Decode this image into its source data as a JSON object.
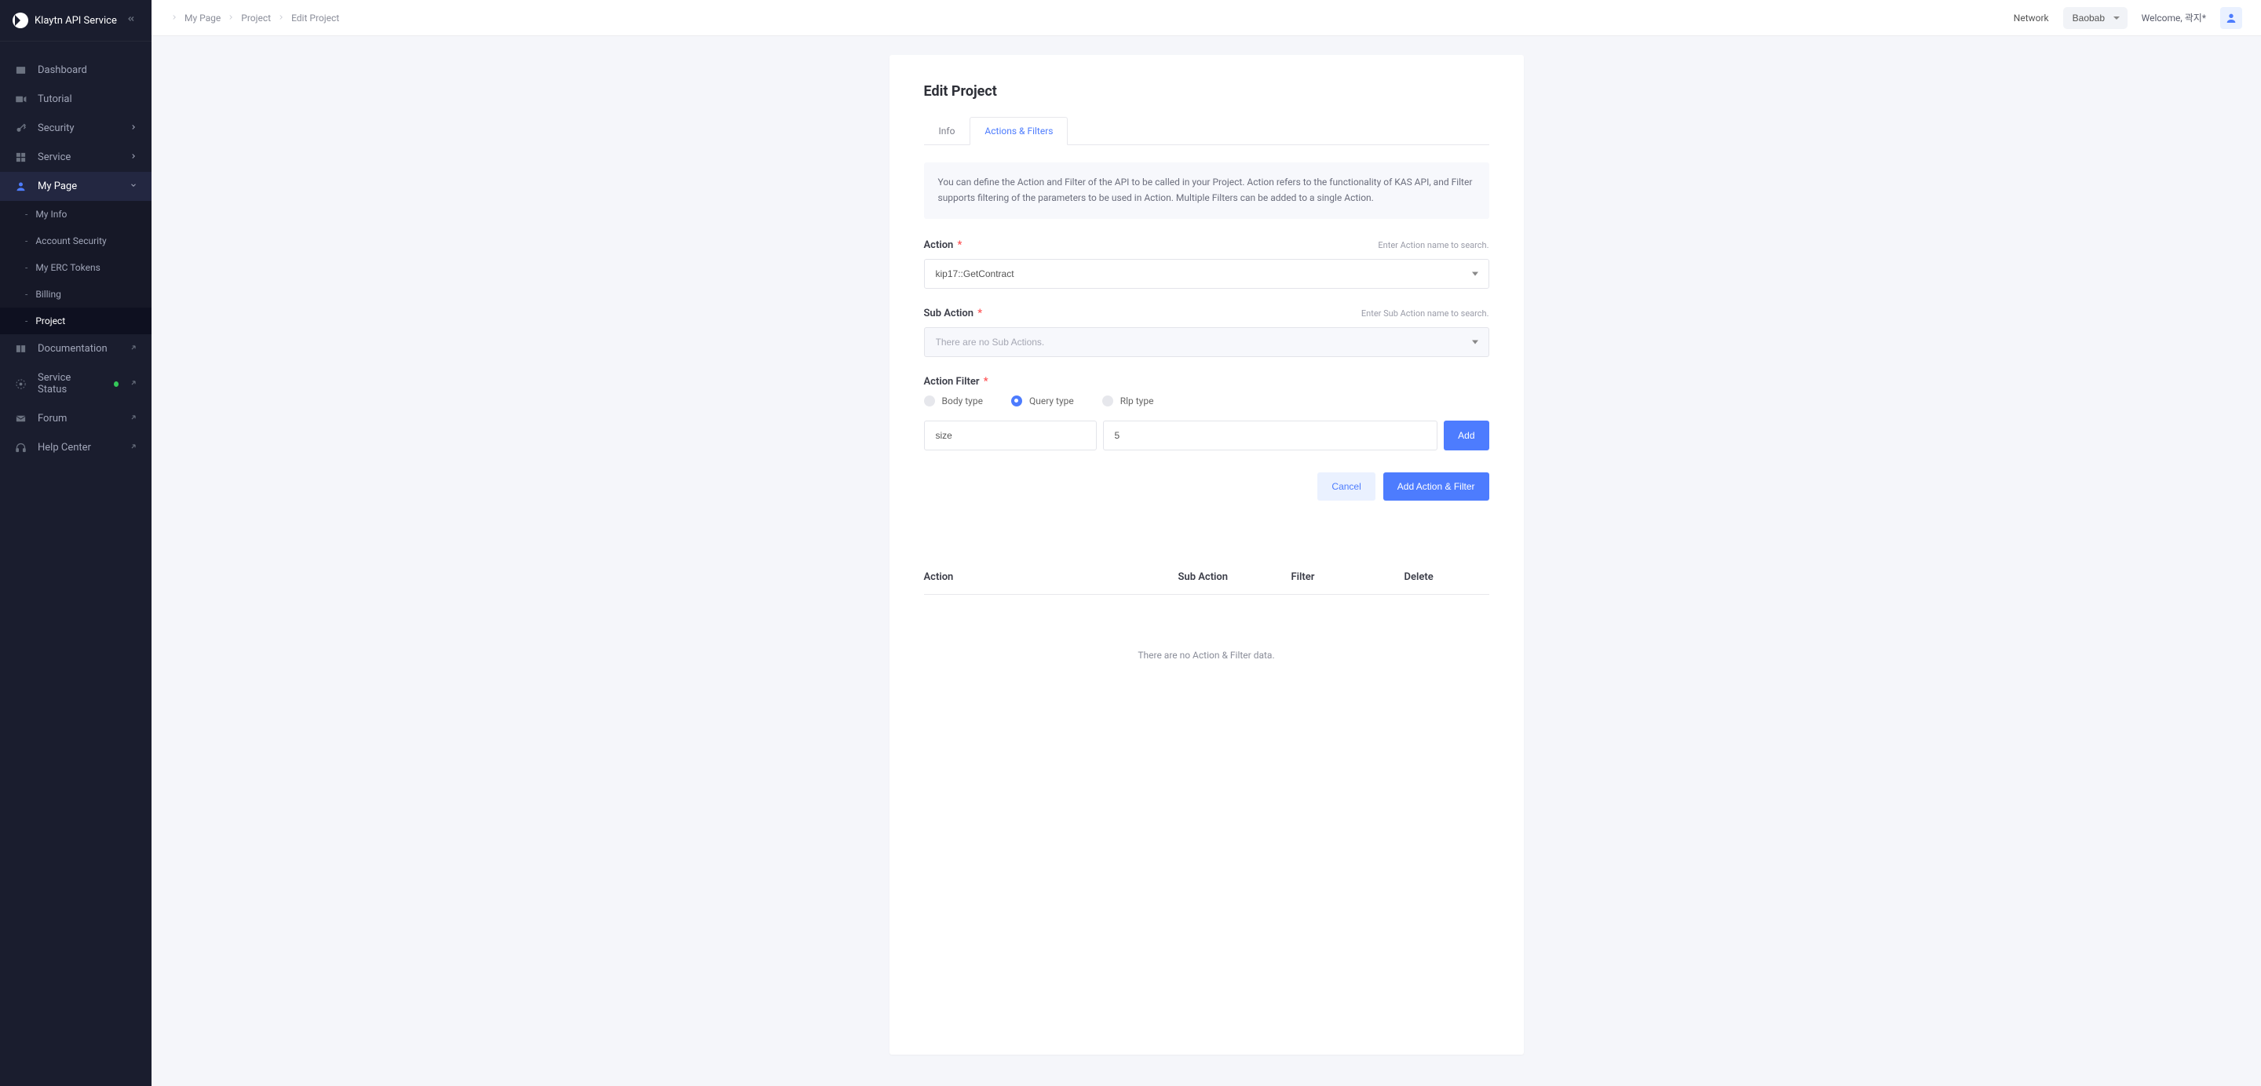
{
  "brand": "Klaytn API Service",
  "sidebar": {
    "items": [
      {
        "label": "Dashboard"
      },
      {
        "label": "Tutorial"
      },
      {
        "label": "Security"
      },
      {
        "label": "Service"
      },
      {
        "label": "My Page"
      },
      {
        "label": "Documentation"
      },
      {
        "label": "Service Status"
      },
      {
        "label": "Forum"
      },
      {
        "label": "Help Center"
      }
    ],
    "mypage_sub": [
      {
        "label": "My Info"
      },
      {
        "label": "Account Security"
      },
      {
        "label": "My ERC Tokens"
      },
      {
        "label": "Billing"
      },
      {
        "label": "Project"
      }
    ]
  },
  "breadcrumb": [
    "My Page",
    "Project",
    "Edit Project"
  ],
  "topbar": {
    "network_label": "Network",
    "network_value": "Baobab",
    "welcome_prefix": "Welcome, ",
    "welcome_user": "곽지*"
  },
  "page": {
    "title": "Edit Project",
    "tabs": [
      "Info",
      "Actions & Filters"
    ],
    "info_text": "You can define the Action and Filter of the API to be called in your Project. Action refers to the functionality of KAS API, and Filter supports filtering of the parameters to be used in Action. Multiple Filters can be added to a single Action.",
    "action": {
      "label": "Action",
      "hint": "Enter Action name to search.",
      "value": "kip17::GetContract"
    },
    "sub_action": {
      "label": "Sub Action",
      "hint": "Enter Sub Action name to search.",
      "placeholder": "There are no Sub Actions."
    },
    "action_filter": {
      "label": "Action Filter",
      "radios": [
        "Body type",
        "Query type",
        "Rlp type"
      ],
      "key_value": "size",
      "val_value": "5",
      "add_btn": "Add"
    },
    "buttons": {
      "cancel": "Cancel",
      "submit": "Add Action & Filter"
    },
    "table": {
      "headers": [
        "Action",
        "Sub Action",
        "Filter",
        "Delete"
      ],
      "empty": "There are no Action & Filter data."
    }
  }
}
